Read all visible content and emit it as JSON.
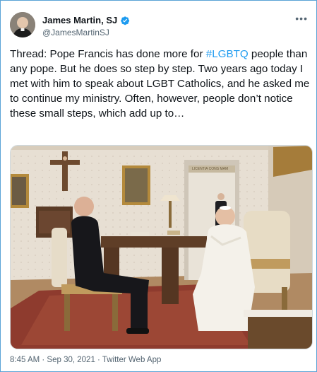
{
  "author": {
    "name": "James Martin, SJ",
    "handle": "@JamesMartinSJ",
    "verified": true
  },
  "tweet": {
    "text_before_hashtag": "Thread: Pope Francis has done more for ",
    "hashtag": "#LGBTQ",
    "text_after_hashtag": " people than any pope. But he does so step by step. Two years ago today I met with him to speak about LGBT Catholics, and he asked me to continue my ministry. Often, however, people don’t notice these small steps, which add up to…"
  },
  "photo": {
    "sign_text": "LICENTIA CONS MAM"
  },
  "meta": {
    "timestamp": "8:45 AM · Sep 30, 2021 · Twitter Web App"
  },
  "icons": {
    "more": "more-horizontal-icon",
    "verified": "verified-badge-icon"
  },
  "colors": {
    "accent": "#1d9bf0",
    "border": "#5aa3d6",
    "secondary_text": "#536471"
  }
}
